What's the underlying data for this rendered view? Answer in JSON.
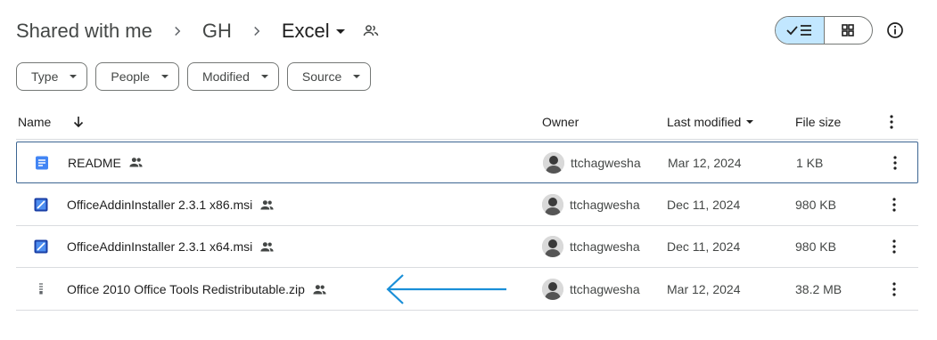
{
  "breadcrumb": {
    "items": [
      "Shared with me",
      "GH",
      "Excel"
    ]
  },
  "filters": [
    "Type",
    "People",
    "Modified",
    "Source"
  ],
  "columns": {
    "name": "Name",
    "owner": "Owner",
    "last_modified": "Last modified",
    "file_size": "File size"
  },
  "rows": [
    {
      "name": "README",
      "owner": "ttchagwesha",
      "modified": "Mar 12, 2024",
      "size": "1 KB",
      "icon": "docs-icon"
    },
    {
      "name": "OfficeAddinInstaller 2.3.1 x86.msi",
      "owner": "ttchagwesha",
      "modified": "Dec 11, 2024",
      "size": "980 KB",
      "icon": "installer-icon"
    },
    {
      "name": "OfficeAddinInstaller 2.3.1 x64.msi",
      "owner": "ttchagwesha",
      "modified": "Dec 11, 2024",
      "size": "980 KB",
      "icon": "installer-icon"
    },
    {
      "name": "Office 2010 Office Tools Redistributable.zip",
      "owner": "ttchagwesha",
      "modified": "Mar 12, 2024",
      "size": "38.2 MB",
      "icon": "zip-icon"
    }
  ],
  "colors": {
    "accent": "#c2e7ff",
    "docs_blue": "#4285f4",
    "arrow_blue": "#1a8fd8"
  }
}
